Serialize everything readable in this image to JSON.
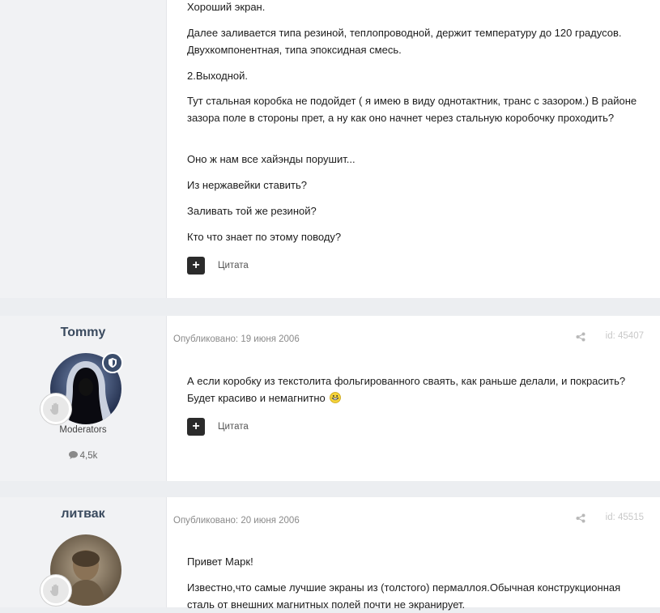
{
  "post1": {
    "paragraphs": [
      "Хороший экран.",
      "Далее заливается типа резиной, теплопроводной, держит температуру до 120 градусов. Двухкомпонентная, типа эпоксидная смесь.",
      "2.Выходной.",
      "Тут стальная коробка не подойдет ( я имею в виду однотактник, транс с зазором.) В районе зазора поле в стороны прет, а ну как оно начнет через стальную коробочку проходить?",
      "Оно ж нам все хайэнды порушит...",
      "Из нержавейки ставить?",
      "Заливать той же резиной?",
      "Кто что знает по этому поводу?"
    ],
    "quote_label": "Цитата"
  },
  "post2": {
    "author": "Tommy",
    "group": "Moderators",
    "post_count": "4,5k",
    "published": "Опубликовано: 19 июня 2006",
    "post_id": "id: 45407",
    "text_line1": "А если коробку из текстолита фольгированного сваять, как раньше делали, и покрасить?",
    "text_line2": "Будет красиво и немагнитно",
    "quote_label": "Цитата"
  },
  "post3": {
    "author": "литвак",
    "published": "Опубликовано: 20 июня 2006",
    "post_id": "id: 45515",
    "paragraphs": [
      "Привет Марк!",
      "Известно,что самые лучшие экраны из (толстого) пермаллоя.Обычная конструкционная сталь от внешних магнитных полей почти не экранирует."
    ]
  },
  "icons": {
    "plus": "plus-icon",
    "share": "share-icon",
    "comment": "comment-icon",
    "emoji": "grin-emoji-icon",
    "shield": "moderator-shield-icon",
    "rank": "rank-hand-icon"
  },
  "colors": {
    "author": "#3a4a5e",
    "shield_badge": "#3b4d6b",
    "button_dark": "#2b2b2b",
    "page_bg": "#eceef1"
  }
}
